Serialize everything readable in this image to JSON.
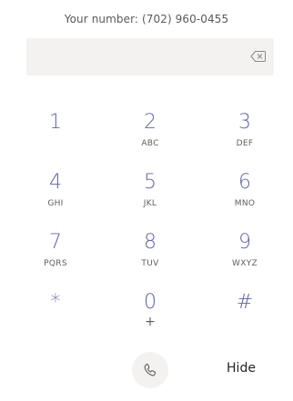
{
  "header": {
    "your_number": "Your number: (702) 960-0455"
  },
  "dial_input": {
    "value": "",
    "placeholder": ""
  },
  "keypad": {
    "keys": [
      {
        "digit": "1",
        "letters": ""
      },
      {
        "digit": "2",
        "letters": "ABC"
      },
      {
        "digit": "3",
        "letters": "DEF"
      },
      {
        "digit": "4",
        "letters": "GHI"
      },
      {
        "digit": "5",
        "letters": "JKL"
      },
      {
        "digit": "6",
        "letters": "MNO"
      },
      {
        "digit": "7",
        "letters": "PQRS"
      },
      {
        "digit": "8",
        "letters": "TUV"
      },
      {
        "digit": "9",
        "letters": "WXYZ"
      },
      {
        "digit": "*",
        "letters": ""
      },
      {
        "digit": "0",
        "letters": "+"
      },
      {
        "digit": "#",
        "letters": ""
      }
    ]
  },
  "footer": {
    "hide_label": "Hide",
    "call_icon": "phone-icon"
  },
  "colors": {
    "accent": "#6264a7",
    "field_background": "#f3f2f1"
  }
}
